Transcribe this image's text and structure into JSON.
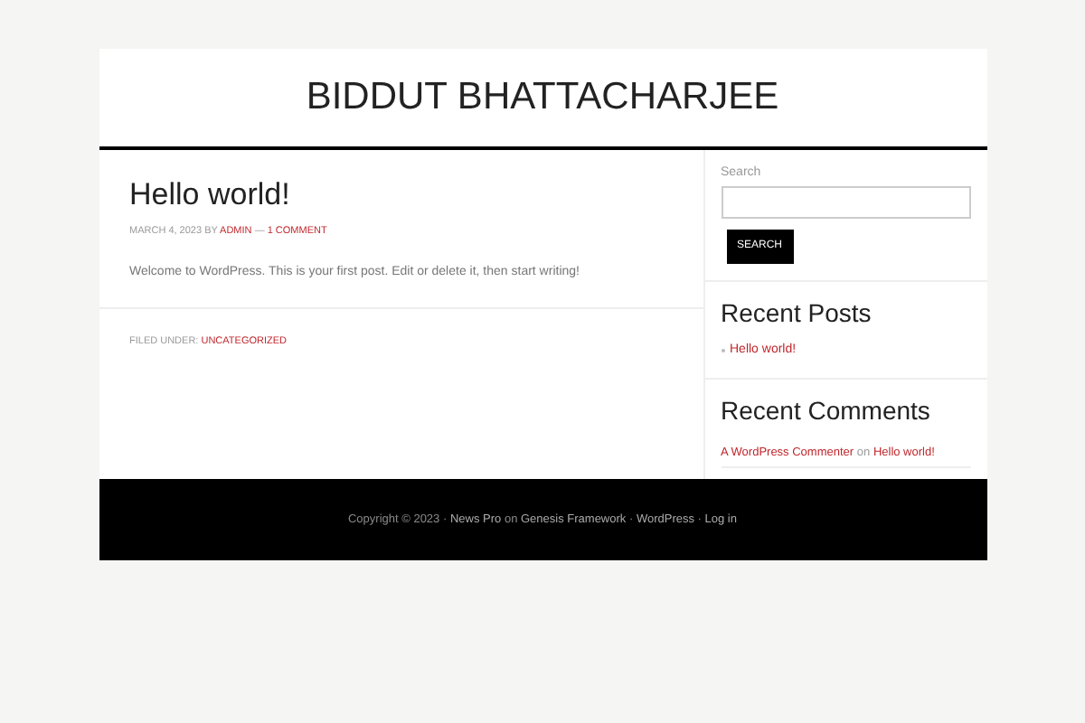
{
  "site_title": "BIDDUT BHATTACHARJEE",
  "post": {
    "title": "Hello world!",
    "meta": [
      {
        "kind": "text",
        "text": "MARCH 4, 2023 BY"
      },
      {
        "kind": "link",
        "text": "ADMIN"
      },
      {
        "kind": "text",
        "text": "—"
      },
      {
        "kind": "link",
        "text": "1 COMMENT"
      }
    ],
    "body": "Welcome to WordPress. This is your first post. Edit or delete it, then start writing!",
    "footer": [
      {
        "kind": "text",
        "text": "FILED UNDER:"
      },
      {
        "kind": "link",
        "text": "UNCATEGORIZED"
      }
    ]
  },
  "sidebar": {
    "search": {
      "label": "Search",
      "button": "SEARCH"
    },
    "recent_posts": {
      "title": "Recent Posts",
      "items": [
        "Hello world!"
      ]
    },
    "recent_comments": {
      "title": "Recent Comments",
      "items": [
        [
          {
            "kind": "link",
            "text": "A WordPress Commenter"
          },
          {
            "kind": "text",
            "text": "on"
          },
          {
            "kind": "link",
            "text": "Hello world!"
          }
        ]
      ]
    }
  },
  "footer": [
    {
      "kind": "text",
      "text": "Copyright © 2023 ·"
    },
    {
      "kind": "link",
      "text": "News Pro"
    },
    {
      "kind": "text",
      "text": "on"
    },
    {
      "kind": "link",
      "text": "Genesis Framework"
    },
    {
      "kind": "text",
      "text": "·"
    },
    {
      "kind": "link",
      "text": "WordPress"
    },
    {
      "kind": "text",
      "text": "·"
    },
    {
      "kind": "link",
      "text": "Log in"
    }
  ]
}
